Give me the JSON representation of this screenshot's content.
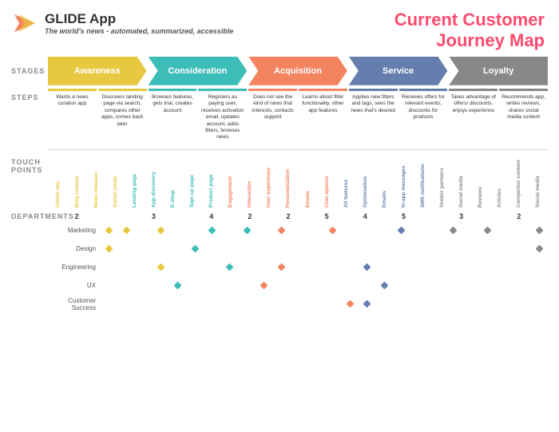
{
  "logo": {
    "title": "GLIDE App",
    "subtitle_italic": "The world's news",
    "subtitle_rest": " - automated, summarized, accessible"
  },
  "page_title": "Current Customer\nJourney Map",
  "stages": [
    {
      "label": "Awareness",
      "color": "#e8c840"
    },
    {
      "label": "Consideration",
      "color": "#3dbdb8"
    },
    {
      "label": "Acquisition",
      "color": "#f4845f"
    },
    {
      "label": "Service",
      "color": "#667eae"
    },
    {
      "label": "Loyalty",
      "color": "#888"
    }
  ],
  "steps": [
    {
      "text": "Wants a news curation app",
      "color": "#e8c840"
    },
    {
      "text": "Discovers landing page via search, compares other apps, comes back later",
      "color": "#e8c840"
    },
    {
      "text": "Browses features, gets trial, creates account",
      "color": "#3dbdb8"
    },
    {
      "text": "Registers as paying user, receives activation email, updates account, adds filters, browses news",
      "color": "#3dbdb8"
    },
    {
      "text": "Does not see the kind of news that interests, contacts support",
      "color": "#f4845f"
    },
    {
      "text": "Learns about filter functionality, other app features",
      "color": "#f4845f"
    },
    {
      "text": "Applies new filters and tags, sees the news that's desired",
      "color": "#667eae"
    },
    {
      "text": "Receives offers for relevant events, discounts for products",
      "color": "#667eae"
    },
    {
      "text": "Takes advantage of offers/ discounts, enjoys experience",
      "color": "#888"
    },
    {
      "text": "Recommends app, writes reviews, shares social media content",
      "color": "#888"
    }
  ],
  "touchpoints": [
    {
      "label": "Online ads",
      "color": "#e8c840"
    },
    {
      "label": "Blog content",
      "color": "#e8c840"
    },
    {
      "label": "News releases",
      "color": "#e8c840"
    },
    {
      "label": "Social media",
      "color": "#e8c840"
    },
    {
      "label": "Landing page",
      "color": "#3dbdb8"
    },
    {
      "label": "App discovery",
      "color": "#3dbdb8"
    },
    {
      "label": "E-shop",
      "color": "#3dbdb8"
    },
    {
      "label": "Sign up page",
      "color": "#3dbdb8"
    },
    {
      "label": "Product page",
      "color": "#3dbdb8"
    },
    {
      "label": "Engagement",
      "color": "#f4845f"
    },
    {
      "label": "Interaction",
      "color": "#f4845f"
    },
    {
      "label": "User experience",
      "color": "#f4845f"
    },
    {
      "label": "Personalization",
      "color": "#f4845f"
    },
    {
      "label": "Emails",
      "color": "#f4845f"
    },
    {
      "label": "Chat options",
      "color": "#f4845f"
    },
    {
      "label": "All features",
      "color": "#667eae"
    },
    {
      "label": "Optimization",
      "color": "#667eae"
    },
    {
      "label": "Emails",
      "color": "#667eae"
    },
    {
      "label": "In-app messages",
      "color": "#667eae"
    },
    {
      "label": "SMS notifications",
      "color": "#667eae"
    },
    {
      "label": "Vendor partners",
      "color": "#888"
    },
    {
      "label": "Social media",
      "color": "#888"
    },
    {
      "label": "Reviews",
      "color": "#888"
    },
    {
      "label": "Articles",
      "color": "#888"
    },
    {
      "label": "Competitor content",
      "color": "#888"
    },
    {
      "label": "Social media",
      "color": "#888"
    }
  ],
  "dept_counts": [
    2,
    3,
    4,
    2,
    2,
    5,
    4,
    5,
    3,
    2
  ],
  "departments": [
    {
      "name": "Marketing",
      "dots": [
        1,
        1,
        0,
        1,
        0,
        0,
        1,
        0,
        1,
        0,
        1,
        0,
        0,
        1,
        0,
        0,
        0,
        1,
        0,
        0,
        1,
        0,
        1,
        0,
        0,
        1
      ]
    },
    {
      "name": "Design",
      "dots": [
        1,
        0,
        0,
        0,
        0,
        1,
        0,
        0,
        0,
        0,
        0,
        0,
        0,
        0,
        0,
        0,
        0,
        0,
        0,
        0,
        0,
        0,
        0,
        0,
        0,
        1
      ]
    },
    {
      "name": "Engineering",
      "dots": [
        0,
        0,
        0,
        1,
        0,
        0,
        0,
        1,
        0,
        0,
        1,
        0,
        0,
        0,
        0,
        1,
        0,
        0,
        0,
        0,
        0,
        0,
        0,
        0,
        0,
        0
      ]
    },
    {
      "name": "UX",
      "dots": [
        0,
        0,
        0,
        0,
        1,
        0,
        0,
        0,
        0,
        1,
        0,
        0,
        0,
        0,
        0,
        0,
        1,
        0,
        0,
        0,
        0,
        0,
        0,
        0,
        0,
        0
      ]
    },
    {
      "name": "Customer Success",
      "dots": [
        0,
        0,
        0,
        0,
        0,
        0,
        0,
        0,
        0,
        0,
        0,
        0,
        0,
        0,
        1,
        1,
        0,
        0,
        0,
        0,
        0,
        0,
        0,
        0,
        0,
        0
      ]
    }
  ],
  "dept_section_label": "DEPARTMENTS"
}
